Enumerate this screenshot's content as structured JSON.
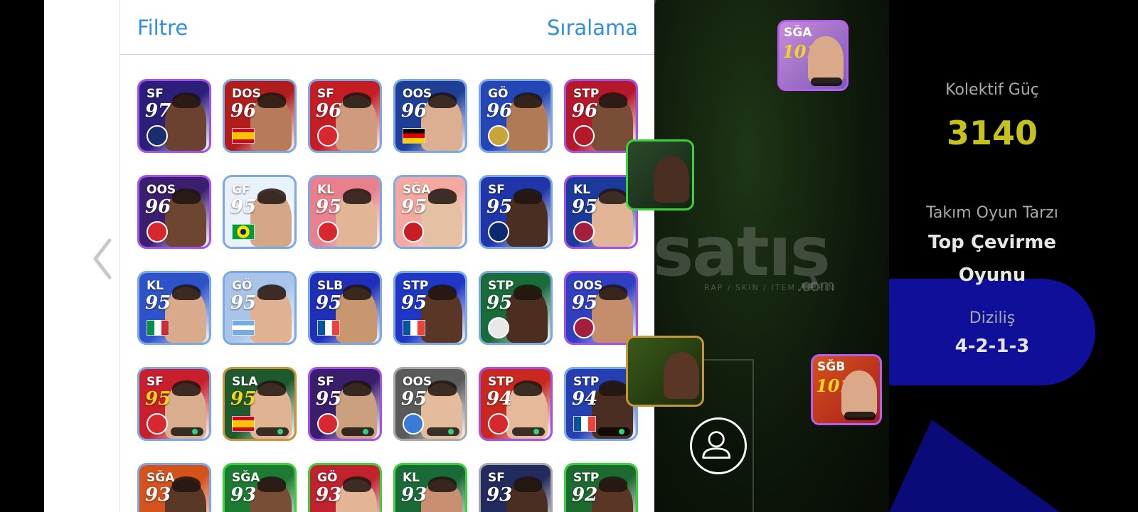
{
  "header": {
    "filter_label": "Filtre",
    "sort_label": "Sıralama"
  },
  "players": [
    {
      "pos": "SF",
      "rating": "97",
      "bg": "#2b1f7a",
      "face": "#6b4230",
      "flag": "badge",
      "flag_color": "#1a2e6e",
      "border": "#a44ff0",
      "gold": false
    },
    {
      "pos": "DOS",
      "rating": "96",
      "bg": "#b11c1c",
      "face": "#b77b5b",
      "flag": "es",
      "border": "#7aa8e8",
      "gold": false
    },
    {
      "pos": "SF",
      "rating": "96",
      "bg": "#c41d24",
      "face": "#d09a7c",
      "flag": "badge",
      "flag_color": "#d7272f",
      "border": "#7aa8e8",
      "gold": false
    },
    {
      "pos": "OOS",
      "rating": "96",
      "bg": "#1e3f95",
      "face": "#dcae92",
      "flag": "de",
      "border": "#7aa8e8",
      "gold": false
    },
    {
      "pos": "GÖ",
      "rating": "96",
      "bg": "#2547b6",
      "face": "#b07a56",
      "flag": "badge",
      "flag_color": "#c9a43a",
      "border": "#7aa8e8",
      "gold": false
    },
    {
      "pos": "STP",
      "rating": "96",
      "bg": "#b5182a",
      "face": "#7a4e36",
      "flag": "badge",
      "flag_color": "#b5182a",
      "border": "#a44ff0",
      "gold": false
    },
    {
      "pos": "OOS",
      "rating": "96",
      "bg": "#3b1f6e",
      "face": "#6e4530",
      "flag": "badge",
      "flag_color": "#d7272f",
      "border": "#a44ff0",
      "gold": false
    },
    {
      "pos": "GF",
      "rating": "95",
      "bg": "#e9f1fb",
      "face": "#d6a787",
      "flag": "br",
      "border": "#7aa8e8",
      "gold": false
    },
    {
      "pos": "KL",
      "rating": "95",
      "bg": "#e8808d",
      "face": "#e2b597",
      "flag": "badge",
      "flag_color": "#d7272f",
      "border": "#7aa8e8",
      "gold": false
    },
    {
      "pos": "SĞA",
      "rating": "95",
      "bg": "#f3a9a0",
      "face": "#e6c0a3",
      "flag": "badge",
      "flag_color": "#c81d25",
      "border": "#7aa8e8",
      "gold": false
    },
    {
      "pos": "SF",
      "rating": "95",
      "bg": "#1f35a8",
      "face": "#4a2e22",
      "flag": "badge",
      "flag_color": "#0c2a6e",
      "border": "#7aa8e8",
      "gold": false
    },
    {
      "pos": "KL",
      "rating": "95",
      "bg": "#1b3a9a",
      "face": "#e1b495",
      "flag": "badge",
      "flag_color": "#a31f3d",
      "border": "#a44ff0",
      "gold": false
    },
    {
      "pos": "KL",
      "rating": "95",
      "bg": "#2e52c8",
      "face": "#d9aa8c",
      "flag": "it",
      "border": "#7aa8e8",
      "gold": false
    },
    {
      "pos": "GÖ",
      "rating": "95",
      "bg": "#a8c4e8",
      "face": "#e0b292",
      "flag": "ar",
      "border": "#7aa8e8",
      "gold": false
    },
    {
      "pos": "SLB",
      "rating": "95",
      "bg": "#1f2fb7",
      "face": "#c9976f",
      "flag": "fr",
      "border": "#7aa8e8",
      "gold": false
    },
    {
      "pos": "STP",
      "rating": "95",
      "bg": "#1f37c4",
      "face": "#5a3626",
      "flag": "fr",
      "border": "#7aa8e8",
      "gold": false
    },
    {
      "pos": "STP",
      "rating": "95",
      "bg": "#1a6b3a",
      "face": "#4b2e20",
      "flag": "badge",
      "flag_color": "#e8e8e8",
      "border": "#7aa8e8",
      "gold": false
    },
    {
      "pos": "OOS",
      "rating": "95",
      "bg": "#2f3fbf",
      "face": "#c48e6d",
      "flag": "badge",
      "flag_color": "#a31f3d",
      "border": "#a44ff0",
      "gold": false
    },
    {
      "pos": "SF",
      "rating": "95",
      "bg": "#c81f2c",
      "face": "#dcae90",
      "flag": "badge",
      "flag_color": "#d7272f",
      "border": "#7aa8e8",
      "gold": true
    },
    {
      "pos": "SLA",
      "rating": "95",
      "bg": "#1f5a2e",
      "face": "#e0b393",
      "flag": "es",
      "border": "#c8963a",
      "gold": true
    },
    {
      "pos": "SF",
      "rating": "95",
      "bg": "#3a1d6b",
      "face": "#caa07e",
      "flag": "badge",
      "flag_color": "#d7272f",
      "border": "#a44ff0",
      "gold": false
    },
    {
      "pos": "OOS",
      "rating": "95",
      "bg": "#5a5a5a",
      "face": "#e4bb9c",
      "flag": "badge",
      "flag_color": "#3a7bd5",
      "border": "#a9a9a9",
      "gold": false
    },
    {
      "pos": "STP",
      "rating": "94",
      "bg": "#c8281f",
      "face": "#e5b99a",
      "flag": "badge",
      "flag_color": "#d7272f",
      "border": "#a44ff0",
      "gold": false
    },
    {
      "pos": "STP",
      "rating": "94",
      "bg": "#263fb0",
      "face": "#4b2e22",
      "flag": "fr",
      "border": "#7aa8e8",
      "gold": false
    },
    {
      "pos": "SĞA",
      "rating": "93",
      "bg": "#d4521c",
      "face": "#5a3828",
      "flag": "none",
      "border": "#7aa8e8",
      "gold": false
    },
    {
      "pos": "SĞA",
      "rating": "93",
      "bg": "#1d7a32",
      "face": "#7a4e36",
      "flag": "none",
      "border": "#3ad13a",
      "gold": false
    },
    {
      "pos": "GÖ",
      "rating": "93",
      "bg": "#c0222e",
      "face": "#e3b596",
      "flag": "none",
      "border": "#3ad13a",
      "gold": false
    },
    {
      "pos": "KL",
      "rating": "93",
      "bg": "#1a6a38",
      "face": "#c89070",
      "flag": "none",
      "border": "#3ad13a",
      "gold": false
    },
    {
      "pos": "SF",
      "rating": "93",
      "bg": "#222a5e",
      "face": "#4a2e22",
      "flag": "none",
      "border": "#a9a9a9",
      "gold": false
    },
    {
      "pos": "STP",
      "rating": "92",
      "bg": "#1d6a30",
      "face": "#5a3626",
      "flag": "none",
      "border": "#3ad13a",
      "gold": false
    }
  ],
  "pitch_cards": [
    {
      "pos": "SĞA",
      "rating": "101"
    },
    {
      "pos": "SĞB",
      "rating": "101"
    }
  ],
  "watermark": {
    "main": "satış",
    "sub": "RAP / SKIN / ITEM / E-PIN",
    "com": ".com"
  },
  "info": {
    "power_label": "Kolektif Güç",
    "power_value": "3140",
    "style_label": "Takım Oyun Tarzı",
    "style_value_1": "Top Çevirme",
    "style_value_2": "Oyunu",
    "formation_label": "Diziliş",
    "formation_value": "4-2-1-3"
  },
  "colors": {
    "accent": "#2d8ee2",
    "power": "#c7c21a"
  }
}
